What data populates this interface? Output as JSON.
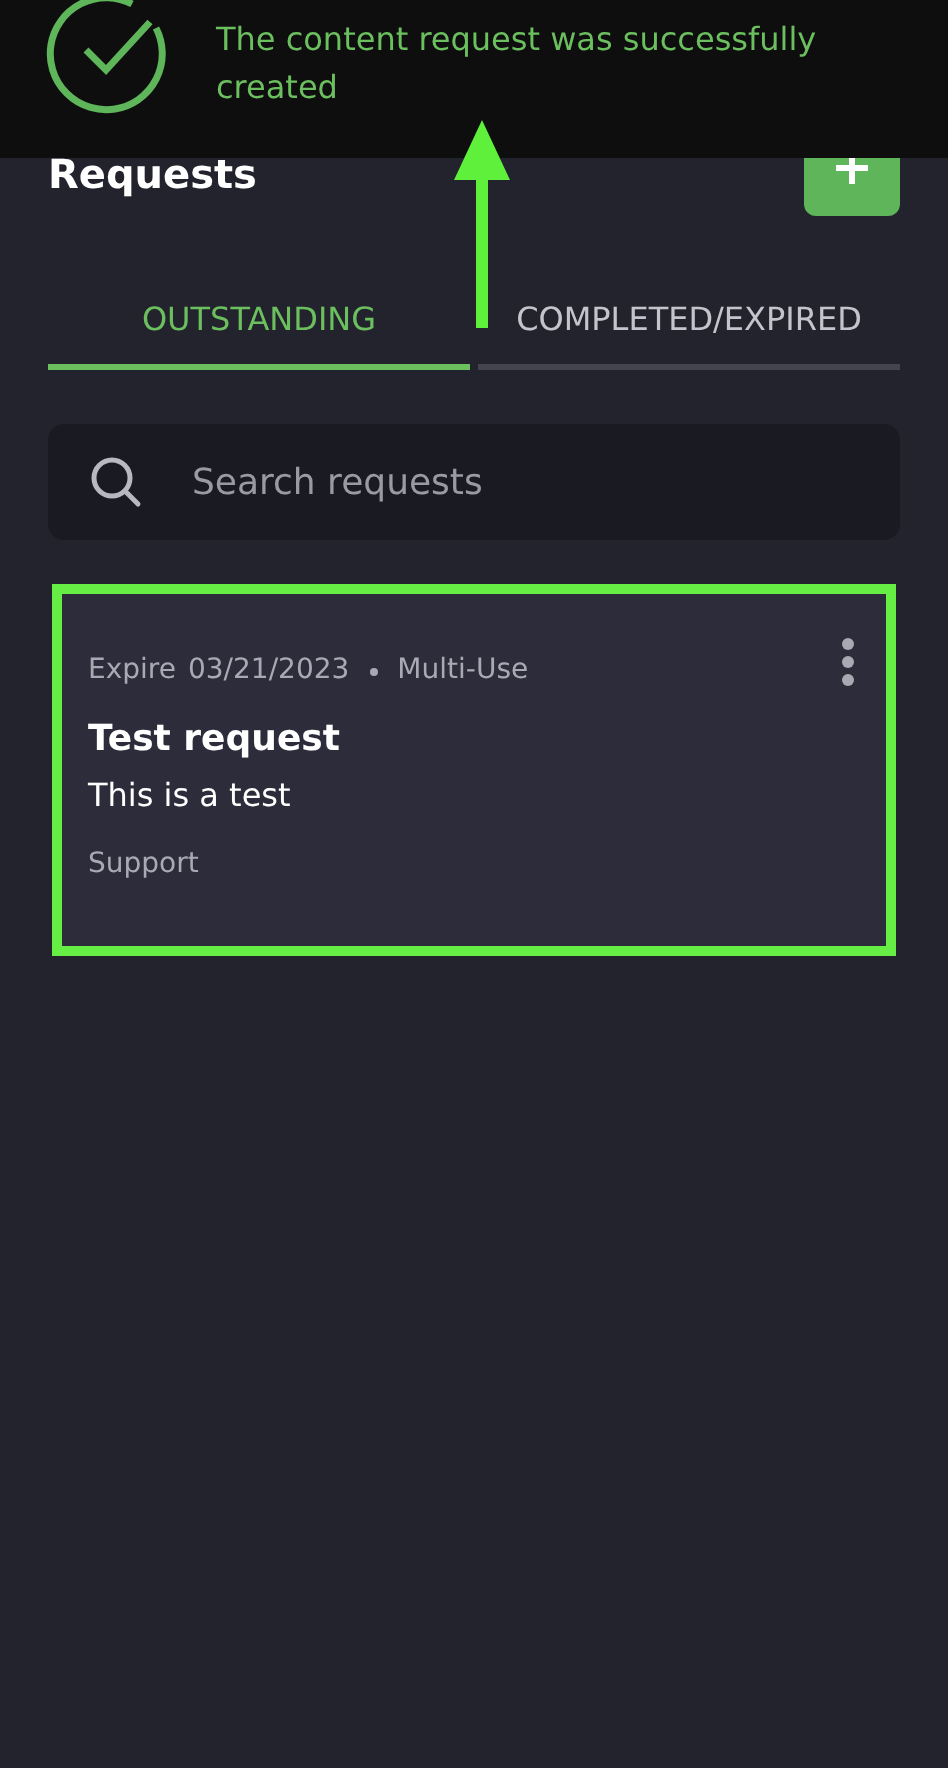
{
  "toast": {
    "message": "The content request was successfully created"
  },
  "header": {
    "title": "Requests"
  },
  "tabs": [
    {
      "label": "OUTSTANDING",
      "selected": true
    },
    {
      "label": "COMPLETED/EXPIRED",
      "selected": false
    }
  ],
  "search": {
    "placeholder": "Search requests"
  },
  "requests": [
    {
      "expire_label": "Expire",
      "expire_date": "03/21/2023",
      "usage": "Multi-Use",
      "title": "Test request",
      "description": "This is a test",
      "category": "Support",
      "highlighted": true
    }
  ]
}
